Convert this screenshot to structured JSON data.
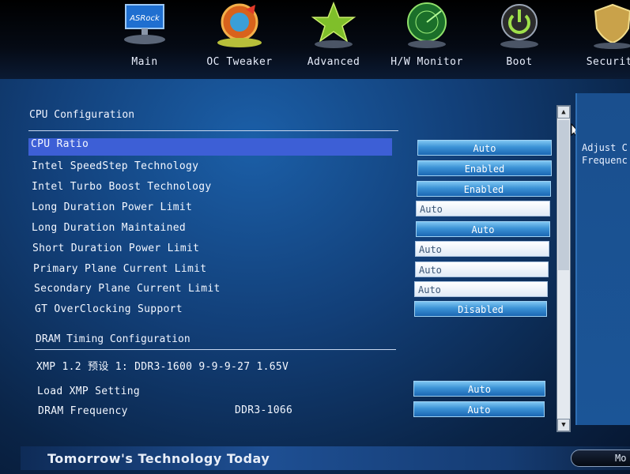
{
  "nav": {
    "tabs": [
      {
        "label": "Main",
        "icon": "monitor-icon"
      },
      {
        "label": "OC Tweaker",
        "icon": "tweaker-icon"
      },
      {
        "label": "Advanced",
        "icon": "star-icon"
      },
      {
        "label": "H/W Monitor",
        "icon": "radar-icon"
      },
      {
        "label": "Boot",
        "icon": "power-icon"
      },
      {
        "label": "Security",
        "icon": "shield-icon"
      }
    ],
    "logo_text": "ASRock"
  },
  "cpu": {
    "title": "CPU Configuration",
    "rows": [
      {
        "label": "CPU Ratio",
        "value": "Auto",
        "kind": "button"
      },
      {
        "label": "Intel SpeedStep Technology",
        "value": "Enabled",
        "kind": "button"
      },
      {
        "label": "Intel Turbo Boost Technology",
        "value": "Enabled",
        "kind": "button"
      },
      {
        "label": "Long Duration Power Limit",
        "value": "Auto",
        "kind": "input"
      },
      {
        "label": "Long Duration Maintained",
        "value": "Auto",
        "kind": "button"
      },
      {
        "label": "Short Duration Power Limit",
        "value": "Auto",
        "kind": "input"
      },
      {
        "label": "Primary Plane Current Limit",
        "value": "Auto",
        "kind": "input"
      },
      {
        "label": "Secondary Plane Current Limit",
        "value": "Auto",
        "kind": "input"
      },
      {
        "label": "GT OverClocking Support",
        "value": "Disabled",
        "kind": "button"
      }
    ]
  },
  "dram": {
    "title": "DRAM Timing Configuration",
    "xmp_info": "XMP 1.2 预设 1: DDR3-1600 9-9-9-27 1.65V",
    "rows": [
      {
        "label": "Load XMP Setting",
        "value": "Auto",
        "current": ""
      },
      {
        "label": "DRAM Frequency",
        "value": "Auto",
        "current": "DDR3-1066"
      }
    ]
  },
  "help": {
    "line1": "Adjust C",
    "line2": "Frequenc"
  },
  "footer": {
    "slogan": "Tomorrow's Technology Today",
    "button": "Mo"
  }
}
